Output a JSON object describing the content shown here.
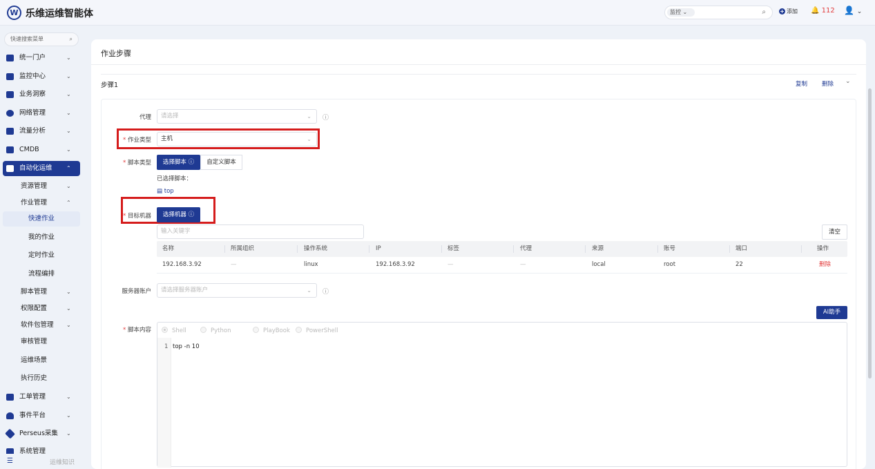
{
  "app": {
    "logo": "W",
    "title": "乐维运维智能体"
  },
  "header": {
    "search_select": "监控",
    "add_label": "添加",
    "alert_count": "112"
  },
  "sidebar": {
    "search_placeholder": "快速搜索菜单",
    "items": [
      {
        "label": "统一门户"
      },
      {
        "label": "监控中心"
      },
      {
        "label": "业务洞察"
      },
      {
        "label": "网络管理"
      },
      {
        "label": "流量分析"
      },
      {
        "label": "CMDB"
      },
      {
        "label": "自动化运维"
      }
    ],
    "sub_items": [
      {
        "label": "资源管理"
      },
      {
        "label": "作业管理"
      },
      {
        "label": "快速作业"
      },
      {
        "label": "我的作业"
      },
      {
        "label": "定时作业"
      },
      {
        "label": "流程编排"
      },
      {
        "label": "脚本管理"
      },
      {
        "label": "权限配置"
      },
      {
        "label": "软件包管理"
      },
      {
        "label": "审核管理"
      },
      {
        "label": "运维场景"
      },
      {
        "label": "执行历史"
      }
    ],
    "bottom_items": [
      {
        "label": "工单管理"
      },
      {
        "label": "事件平台"
      },
      {
        "label": "Perseus采集"
      },
      {
        "label": "系统管理"
      }
    ],
    "footer": "运维知识"
  },
  "page": {
    "title": "作业步骤",
    "step": "步骤1",
    "copy": "复制",
    "delete": "删除"
  },
  "form": {
    "agent_label": "代理",
    "agent_placeholder": "请选择",
    "job_type_label": "作业类型",
    "job_type_value": "主机",
    "script_type_label": "脚本类型",
    "select_script": "选择脚本",
    "custom_script": "自定义脚本",
    "selected_script_label": "已选择脚本：",
    "selected_script": "top",
    "target_label": "目标机器",
    "select_machine": "选择机器",
    "keyword_placeholder": "输入关键字",
    "clear": "清空",
    "server_account_label": "服务器账户",
    "server_account_placeholder": "请选择服务器账户",
    "ai_button": "AI助手",
    "script_content_label": "脚本内容",
    "script_types": [
      "Shell",
      "Python",
      "PlayBook",
      "PowerShell"
    ],
    "code_line_no": "1",
    "code": "top -n 10"
  },
  "table": {
    "headers": [
      "名称",
      "所属组织",
      "操作系统",
      "IP",
      "标签",
      "代理",
      "来源",
      "账号",
      "端口",
      "操作"
    ],
    "rows": [
      [
        "192.168.3.92",
        "—",
        "linux",
        "192.168.3.92",
        "—",
        "—",
        "local",
        "root",
        "22",
        "删除"
      ]
    ]
  }
}
